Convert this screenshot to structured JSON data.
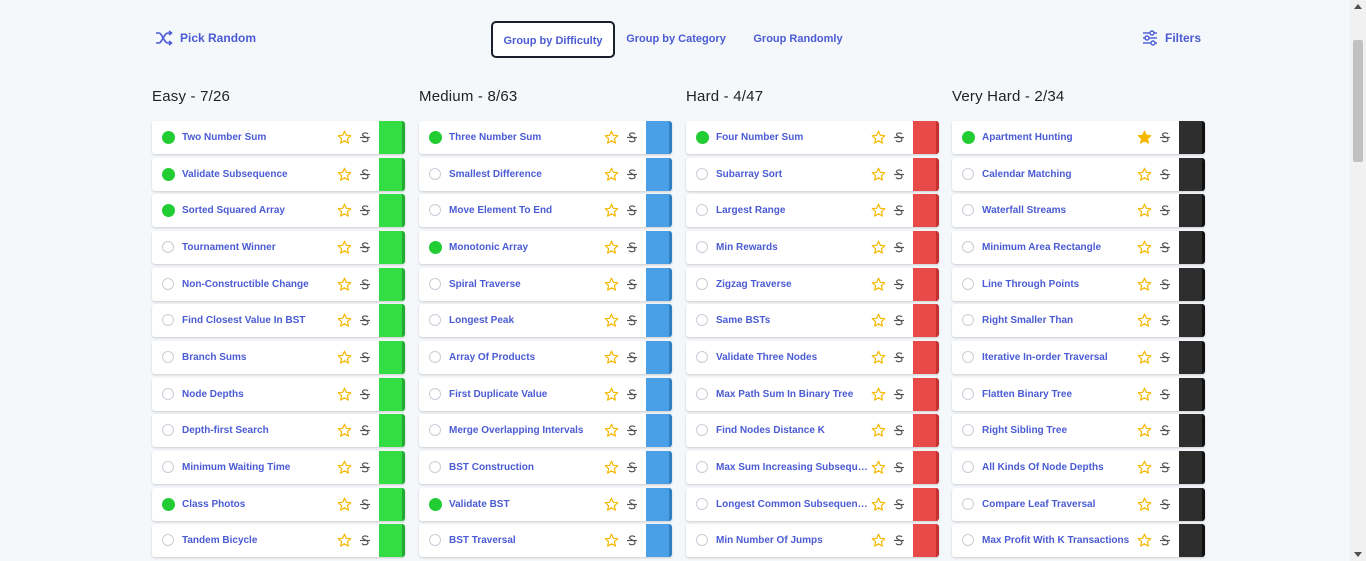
{
  "toolbar": {
    "pick_random": "Pick Random",
    "group_by_difficulty": "Group by Difficulty",
    "group_by_category": "Group by Category",
    "group_randomly": "Group Randomly",
    "filters": "Filters",
    "pick_random_icon": "shuffle-icon",
    "filters_icon": "sliders-icon",
    "active_group": "Group by Difficulty"
  },
  "columns": [
    {
      "title": "Easy - 7/26",
      "color": "#33dd44",
      "color_dark": "#22aa33",
      "questions": [
        {
          "name": "Two Number Sum",
          "done": true,
          "starred": false
        },
        {
          "name": "Validate Subsequence",
          "done": true,
          "starred": false
        },
        {
          "name": "Sorted Squared Array",
          "done": true,
          "starred": false
        },
        {
          "name": "Tournament Winner",
          "done": false,
          "starred": false
        },
        {
          "name": "Non-Constructible Change",
          "done": false,
          "starred": false
        },
        {
          "name": "Find Closest Value In BST",
          "done": false,
          "starred": false
        },
        {
          "name": "Branch Sums",
          "done": false,
          "starred": false
        },
        {
          "name": "Node Depths",
          "done": false,
          "starred": false
        },
        {
          "name": "Depth-first Search",
          "done": false,
          "starred": false
        },
        {
          "name": "Minimum Waiting Time",
          "done": false,
          "starred": false
        },
        {
          "name": "Class Photos",
          "done": true,
          "starred": false
        },
        {
          "name": "Tandem Bicycle",
          "done": false,
          "starred": false
        }
      ]
    },
    {
      "title": "Medium - 8/63",
      "color": "#4aa0e6",
      "color_dark": "#2f7fc4",
      "questions": [
        {
          "name": "Three Number Sum",
          "done": true,
          "starred": false
        },
        {
          "name": "Smallest Difference",
          "done": false,
          "starred": false
        },
        {
          "name": "Move Element To End",
          "done": false,
          "starred": false
        },
        {
          "name": "Monotonic Array",
          "done": true,
          "starred": false
        },
        {
          "name": "Spiral Traverse",
          "done": false,
          "starred": false
        },
        {
          "name": "Longest Peak",
          "done": false,
          "starred": false
        },
        {
          "name": "Array Of Products",
          "done": false,
          "starred": false
        },
        {
          "name": "First Duplicate Value",
          "done": false,
          "starred": false
        },
        {
          "name": "Merge Overlapping Intervals",
          "done": false,
          "starred": false
        },
        {
          "name": "BST Construction",
          "done": false,
          "starred": false
        },
        {
          "name": "Validate BST",
          "done": true,
          "starred": false
        },
        {
          "name": "BST Traversal",
          "done": false,
          "starred": false
        }
      ]
    },
    {
      "title": "Hard - 4/47",
      "color": "#e84a4a",
      "color_dark": "#c42f2f",
      "questions": [
        {
          "name": "Four Number Sum",
          "done": true,
          "starred": false
        },
        {
          "name": "Subarray Sort",
          "done": false,
          "starred": false
        },
        {
          "name": "Largest Range",
          "done": false,
          "starred": false
        },
        {
          "name": "Min Rewards",
          "done": false,
          "starred": false
        },
        {
          "name": "Zigzag Traverse",
          "done": false,
          "starred": false
        },
        {
          "name": "Same BSTs",
          "done": false,
          "starred": false
        },
        {
          "name": "Validate Three Nodes",
          "done": false,
          "starred": false
        },
        {
          "name": "Max Path Sum In Binary Tree",
          "done": false,
          "starred": false
        },
        {
          "name": "Find Nodes Distance K",
          "done": false,
          "starred": false
        },
        {
          "name": "Max Sum Increasing Subsequence",
          "done": false,
          "starred": false
        },
        {
          "name": "Longest Common Subsequence",
          "done": false,
          "starred": false
        },
        {
          "name": "Min Number Of Jumps",
          "done": false,
          "starred": false
        }
      ]
    },
    {
      "title": "Very Hard - 2/34",
      "color": "#2e2e2e",
      "color_dark": "#111111",
      "questions": [
        {
          "name": "Apartment Hunting",
          "done": true,
          "starred": true
        },
        {
          "name": "Calendar Matching",
          "done": false,
          "starred": false
        },
        {
          "name": "Waterfall Streams",
          "done": false,
          "starred": false
        },
        {
          "name": "Minimum Area Rectangle",
          "done": false,
          "starred": false
        },
        {
          "name": "Line Through Points",
          "done": false,
          "starred": false
        },
        {
          "name": "Right Smaller Than",
          "done": false,
          "starred": false
        },
        {
          "name": "Iterative In-order Traversal",
          "done": false,
          "starred": false
        },
        {
          "name": "Flatten Binary Tree",
          "done": false,
          "starred": false
        },
        {
          "name": "Right Sibling Tree",
          "done": false,
          "starred": false
        },
        {
          "name": "All Kinds Of Node Depths",
          "done": false,
          "starred": false
        },
        {
          "name": "Compare Leaf Traversal",
          "done": false,
          "starred": false
        },
        {
          "name": "Max Profit With K Transactions",
          "done": false,
          "starred": false
        }
      ]
    }
  ],
  "colors": {
    "accent": "#4a5bd4",
    "star": "#f5b800",
    "done": "#22cc33"
  }
}
